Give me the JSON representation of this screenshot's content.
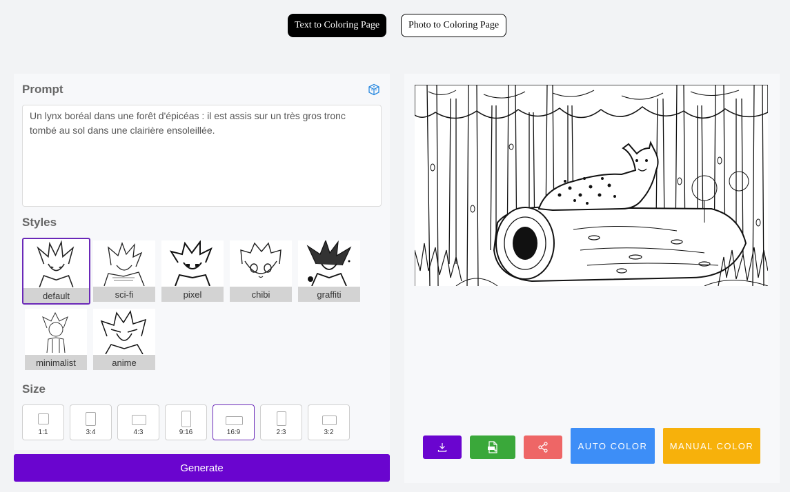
{
  "tabs": [
    {
      "label": "Text to Coloring Page",
      "active": true
    },
    {
      "label": "Photo to Coloring Page",
      "active": false
    }
  ],
  "prompt": {
    "label": "Prompt",
    "value": "Un lynx boréal dans une forêt d'épicéas : il est assis sur un très gros tronc tombé au sol dans une clairière ensoleillée."
  },
  "styles": {
    "label": "Styles",
    "items": [
      {
        "label": "default",
        "selected": true
      },
      {
        "label": "sci-fi",
        "selected": false
      },
      {
        "label": "pixel",
        "selected": false
      },
      {
        "label": "chibi",
        "selected": false
      },
      {
        "label": "graffiti",
        "selected": false
      },
      {
        "label": "minimalist",
        "selected": false
      },
      {
        "label": "anime",
        "selected": false
      }
    ]
  },
  "size": {
    "label": "Size",
    "options": [
      "1:1",
      "3:4",
      "4:3",
      "9:16",
      "16:9",
      "2:3",
      "3:2"
    ],
    "selected": "16:9"
  },
  "generate_label": "Generate",
  "actions": {
    "auto_color": "AUTO COLOR",
    "manual_color": "MANUAL COLOR"
  },
  "icons": {
    "prompt_helper": "cube-icon",
    "download": "download-icon",
    "pdf": "pdf-icon",
    "share": "share-icon"
  },
  "colors": {
    "primary": "#6a05cf",
    "pdf": "#3aa83a",
    "share": "#ee6666",
    "auto": "#3d8ef7",
    "manual": "#f7b10b"
  }
}
